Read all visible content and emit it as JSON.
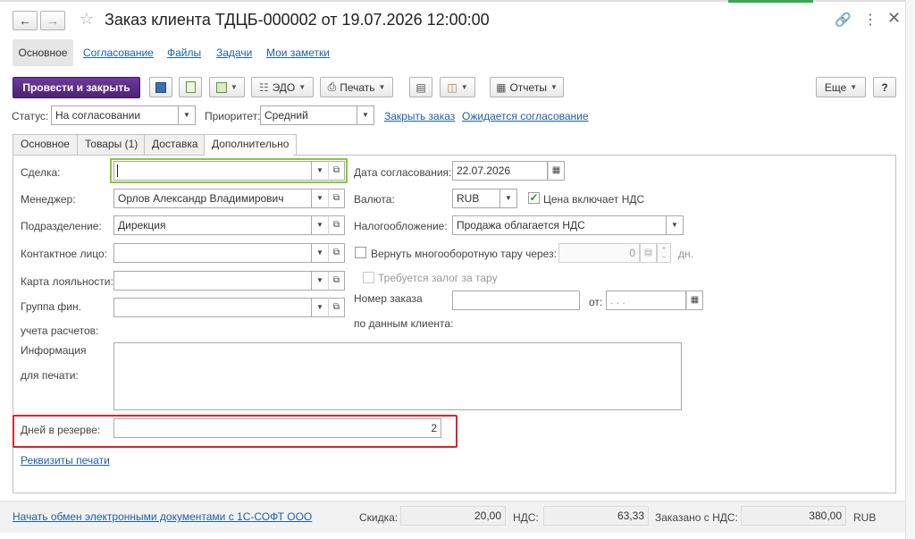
{
  "window": {
    "title": "Заказ клиента ТДЦБ-000002 от 19.07.2026 12:00:00",
    "nav_tabs": [
      "Основное",
      "Согласование",
      "Файлы",
      "Задачи",
      "Мои заметки"
    ]
  },
  "toolbar": {
    "post_close": "Провести и закрыть",
    "edo": "ЭДО",
    "print": "Печать",
    "reports": "Отчеты",
    "more": "Еще",
    "help": "?"
  },
  "status_row": {
    "status_label": "Статус:",
    "status_value": "На согласовании",
    "priority_label": "Приоритет:",
    "priority_value": "Средний",
    "close_order_link": "Закрыть заказ",
    "awaiting_link": "Ожидается согласование"
  },
  "tabs": [
    "Основное",
    "Товары (1)",
    "Доставка",
    "Дополнительно"
  ],
  "left": {
    "deal_label": "Сделка:",
    "deal_value": "",
    "manager_label": "Менеджер:",
    "manager_value": "Орлов Александр Владимирович",
    "division_label": "Подразделение:",
    "division_value": "Дирекция",
    "contact_label": "Контактное лицо:",
    "contact_value": "",
    "loyalty_label": "Карта лояльности:",
    "loyalty_value": "",
    "fin_group_label1": "Группа фин.",
    "fin_group_label2": "учета расчетов:",
    "fin_group_value": "",
    "info_label1": "Информация",
    "info_label2": "для печати:",
    "info_value": "",
    "reserve_label": "Дней в резерве:",
    "reserve_value": "2",
    "print_details_link": "Реквизиты печати"
  },
  "right": {
    "approval_date_label": "Дата согласования:",
    "approval_date_value": "22.07.2026",
    "currency_label": "Валюта:",
    "currency_value": "RUB",
    "vat_included_label": "Цена включает НДС",
    "vat_included": true,
    "taxation_label": "Налогообложение:",
    "taxation_value": "Продажа облагается НДС",
    "return_tare_label": "Вернуть многооборотную тару через:",
    "return_tare_value": "0",
    "days_unit": "дн.",
    "deposit_label": "Требуется залог за тару",
    "order_no_label1": "Номер заказа",
    "order_no_label2": "по данным клиента:",
    "order_no_value": "",
    "from_label": "от:",
    "from_value": ". . ."
  },
  "footer": {
    "edo_link": "Начать обмен электронными документами с 1С-СОФТ ООО",
    "discount_label": "Скидка:",
    "discount_value": "20,00",
    "vat_label": "НДС:",
    "vat_value": "63,33",
    "ordered_label": "Заказано с НДС:",
    "ordered_value": "380,00",
    "currency": "RUB"
  },
  "colors": {
    "accent": "#5b2a86",
    "highlight_box": "#d9262c",
    "focus_border": "#8cc63f",
    "link": "#1f5fa8"
  }
}
